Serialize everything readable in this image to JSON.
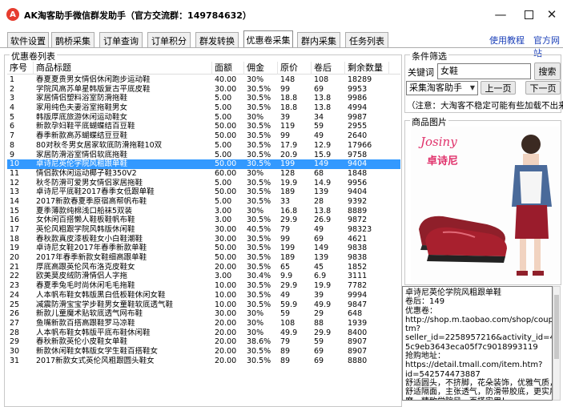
{
  "window": {
    "title": "AK淘客助手微信群发助手（官方交流群：149784632）",
    "icon_name": "ak-logo-icon"
  },
  "tabs": [
    {
      "label": "软件设置"
    },
    {
      "label": "鹊桥采集"
    },
    {
      "label": "订单查询"
    },
    {
      "label": "订单积分"
    },
    {
      "label": "群发转换"
    },
    {
      "label": "优惠卷采集",
      "active": true
    },
    {
      "label": "群内采集"
    },
    {
      "label": "任务列表"
    }
  ],
  "links": {
    "tutorial": "使用教程",
    "website": "官方网站"
  },
  "coupon_list": {
    "group_title": "优惠卷列表",
    "columns": [
      "序号",
      "商品标题",
      "面额",
      "佣金",
      "原价",
      "卷后",
      "剩余数量"
    ],
    "selected_index": 9,
    "rows": [
      [
        "1",
        "春夏夏贵男女情侣休闲跑步运动鞋",
        "40.00",
        "30%",
        "148",
        "108",
        "18289"
      ],
      [
        "2",
        "学院风高苏单星韩版复古平底皮鞋",
        "30.00",
        "30.5%",
        "99",
        "69",
        "9953"
      ],
      [
        "3",
        "家居情侣塑料浴室防滑拖鞋",
        "5.00",
        "30.5%",
        "18.8",
        "13.8",
        "9986"
      ],
      [
        "4",
        "家用纯色夫妻浴室拖鞋男女",
        "5.00",
        "30.5%",
        "18.8",
        "13.8",
        "4994"
      ],
      [
        "5",
        "韩版厚底旅游休闲运动鞋女",
        "5.00",
        "30%",
        "39",
        "34",
        "9987"
      ],
      [
        "6",
        "新款孕妇鞋平底蝴蝶结百豆鞋",
        "50.00",
        "30.5%",
        "119",
        "59",
        "2955"
      ],
      [
        "7",
        "春季新款高苏蝴蝶结豆豆鞋",
        "50.00",
        "30.5%",
        "99",
        "49",
        "2640"
      ],
      [
        "8",
        "80对秋冬男女居家软底防滑拖鞋10双",
        "5.00",
        "30.5%",
        "17.9",
        "12.9",
        "17966"
      ],
      [
        "9",
        "家居防滑浴室情侣软底拖鞋",
        "5.00",
        "30.5%",
        "20.9",
        "15.9",
        "9758"
      ],
      [
        "10",
        "卓诗尼英伦学院风粗跟单鞋",
        "50.00",
        "30.5%",
        "199",
        "149",
        "9404"
      ],
      [
        "11",
        "情侣款休闲运动椰子鞋350V2",
        "60.00",
        "30%",
        "128",
        "68",
        "1848"
      ],
      [
        "12",
        "秋冬防滑可爱男女情侣家居拖鞋",
        "5.00",
        "30.5%",
        "19.9",
        "14.9",
        "9956"
      ],
      [
        "13",
        "卓诗尼平底鞋2017春季女低跟单鞋",
        "50.00",
        "30.5%",
        "189",
        "139",
        "9404"
      ],
      [
        "14",
        "2017新款春夏季原宿高帮帆布鞋",
        "5.00",
        "30.5%",
        "33",
        "28",
        "9392"
      ],
      [
        "15",
        "夏季薄款纯棉浅口船袜5双装",
        "3.00",
        "30%",
        "16.8",
        "13.8",
        "8889"
      ],
      [
        "16",
        " 女休闲百搭懒人鞋板鞋帆布鞋",
        "3.00",
        "30.5%",
        "29.9",
        "26.9",
        "9872"
      ],
      [
        "17",
        "英伦风粗跟学院风韩版休闲鞋",
        "30.00",
        "40.5%",
        "79",
        "49",
        "98323"
      ],
      [
        "18",
        "春秋款真皮漆板鞋女小白鞋潮鞋",
        "30.00",
        "30.5%",
        "99",
        "69",
        "4621"
      ],
      [
        "19",
        "卓诗尼女鞋2017年春季新款单鞋",
        "50.00",
        "30.5%",
        "199",
        "149",
        "9838"
      ],
      [
        "20",
        "2017年春季新款女鞋细高跟单鞋",
        "50.00",
        "30.5%",
        "189",
        "139",
        "9838"
      ],
      [
        "21",
        "厚底高跟英伦风布洛克皮鞋女",
        "20.00",
        "30.5%",
        "65",
        "45",
        "1852"
      ],
      [
        "22",
        "欧美莫皮绒防滑情侣人字拖",
        "3.00",
        "30.4%",
        "9.9",
        "6.9",
        "3111"
      ],
      [
        "23",
        "春夏季兔毛时尚休闲毛毛拖鞋",
        "10.00",
        "30.5%",
        "29.9",
        "19.9",
        "7782"
      ],
      [
        "24",
        "人本帆布鞋女韩版黑白低板鞋休闲女鞋",
        "10.00",
        "30.5%",
        "49",
        "39",
        "9994"
      ],
      [
        "25",
        "减震防滑宝宝学步鞋男女童鞋软底透气鞋",
        "10.00",
        "30.5%",
        "59.9",
        "49.9",
        "9847"
      ],
      [
        "26",
        "新款儿童魔术贴软底透气网布鞋",
        "30.00",
        "30%",
        "59",
        "29",
        "648"
      ],
      [
        "27",
        "鱼嘴新款百搭高跟鞋罗马凉鞋",
        "20.00",
        "30%",
        "108",
        "88",
        "1939"
      ],
      [
        "28",
        "人本帆布鞋女韩版平底布鞋休闲鞋",
        "20.00",
        "30%",
        "49.9",
        "29.9",
        "8400"
      ],
      [
        "29",
        "春秋新款英伦小皮鞋女单鞋",
        "20.00",
        "38.6%",
        "79",
        "59",
        "8907"
      ],
      [
        "30",
        "新款休闲鞋女韩版女学生鞋百搭鞋女",
        "20.00",
        "30.5%",
        "89",
        "69",
        "8907"
      ],
      [
        "31",
        "2017新款女式英伦风粗跟圆头鞋女",
        "20.00",
        "30.5%",
        "89",
        "69",
        "8880"
      ]
    ]
  },
  "filter": {
    "group_title": "条件筛选",
    "keyword_label": "关键词",
    "keyword_value": "女鞋",
    "search_button": "搜索",
    "source_select": "采集淘客助手",
    "prev_button": "上一页",
    "next_button": "下一页",
    "note": "（注意：大淘客不稳定可能有些加载不出来"
  },
  "product_image": {
    "group_title": "商品图片",
    "brand_logo": "Josiny",
    "brand_cn": "卓诗尼"
  },
  "detail_text": [
    "卓诗尼英伦学院风粗跟单鞋",
    "卷后：149",
    "优惠卷：",
    "http://shop.m.taobao.com/shop/coupon.h",
    "tm?",
    "seller_id=2258957216&activity_id=4c753",
    "5c9eb3643eca05f7c9018993119",
    "抢购地址：",
    "https://detail.tmall.com/item.htm?",
    "id=542574473887",
    "舒适圆头，不挤脚，花朵装饰，优雅气质，",
    "舒适隔面，主张透气，防滑带胶底，更实用耐",
    "磨，精致学院风，百搭实用！"
  ]
}
